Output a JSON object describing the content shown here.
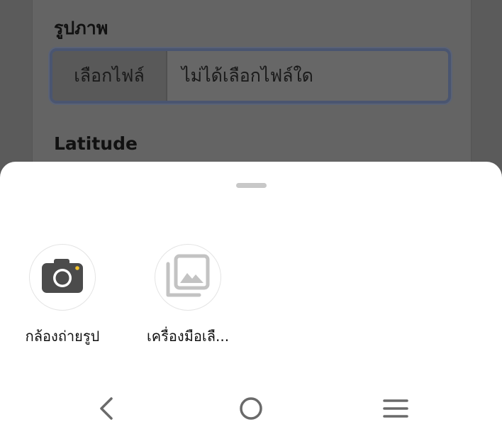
{
  "form": {
    "image_label": "รูปภาพ",
    "file_button": "เลือกไฟล์",
    "file_status": "ไม่ได้เลือกไฟล์ใด",
    "latitude_label": "Latitude"
  },
  "sheet": {
    "options": [
      {
        "label": "กล้องถ่ายรูป",
        "icon": "camera-icon"
      },
      {
        "label": "เครื่องมือเลื...",
        "icon": "gallery-icon"
      }
    ]
  },
  "navbar": {
    "icons": [
      "back-icon",
      "home-icon",
      "menu-icon"
    ]
  }
}
